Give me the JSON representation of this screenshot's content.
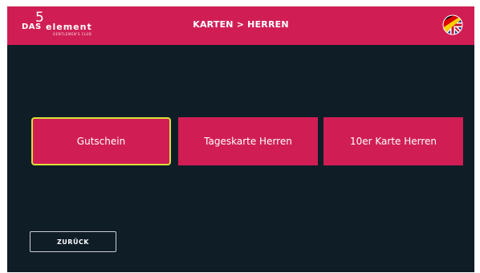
{
  "header": {
    "logo_das": "DAS",
    "logo_five": "5",
    "logo_element": "element",
    "logo_subtitle": "GENTLEMEN'S CLUB",
    "title": "KARTEN > HERREN",
    "language_icon": "flag-de-uk-icon"
  },
  "tiles": [
    {
      "label": "Gutschein",
      "selected": true
    },
    {
      "label": "Tageskarte Herren",
      "selected": false
    },
    {
      "label": "10er Karte Herren",
      "selected": false
    }
  ],
  "back_button": {
    "label": "ZURÜCK"
  },
  "colors": {
    "brand": "#d01e55",
    "background": "#0f1d27",
    "focus_outline": "#d8e03a"
  }
}
